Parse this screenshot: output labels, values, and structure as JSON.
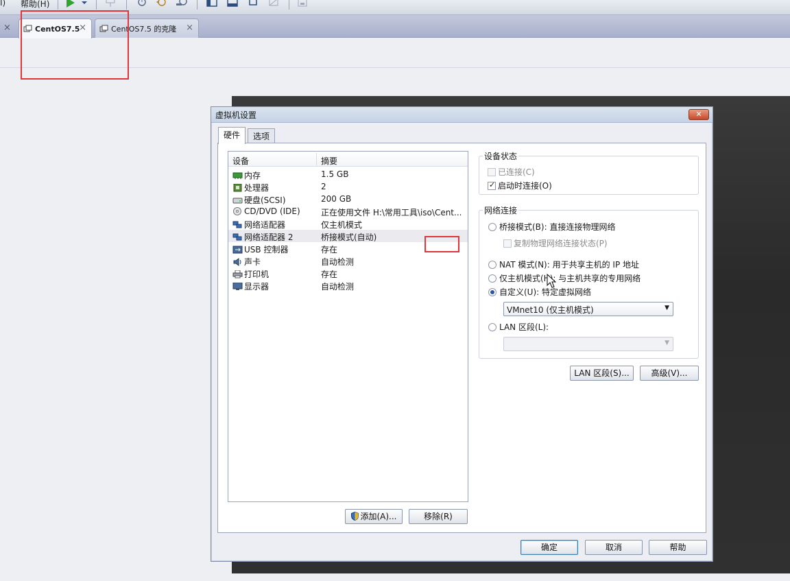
{
  "menubar": {
    "partial_item": "I)",
    "help_label": "帮助(H)"
  },
  "vm_tabs": [
    {
      "label": "CentOS7.5",
      "close": "×"
    },
    {
      "label": "CentOS7.5 的克隆",
      "close": "×"
    }
  ],
  "leftover_close": "×",
  "dialog": {
    "title": "虚拟机设置",
    "close": "✕",
    "tabs": {
      "hardware": "硬件",
      "options": "选项"
    },
    "device_table": {
      "col_device": "设备",
      "col_summary": "摘要",
      "rows": [
        {
          "name": "内存",
          "summary": "1.5 GB",
          "icon": "memory-icon"
        },
        {
          "name": "处理器",
          "summary": "2",
          "icon": "cpu-icon"
        },
        {
          "name": "硬盘(SCSI)",
          "summary": "200 GB",
          "icon": "harddisk-icon"
        },
        {
          "name": "CD/DVD (IDE)",
          "summary": "正在使用文件 H:\\常用工具\\iso\\Cent...",
          "icon": "cd-dvd-icon"
        },
        {
          "name": "网络适配器",
          "summary": "仅主机模式",
          "icon": "network-adapter-icon"
        },
        {
          "name": "网络适配器 2",
          "summary": "桥接模式(自动)",
          "icon": "network-adapter-icon"
        },
        {
          "name": "USB 控制器",
          "summary": "存在",
          "icon": "usb-icon"
        },
        {
          "name": "声卡",
          "summary": "自动检测",
          "icon": "sound-icon"
        },
        {
          "name": "打印机",
          "summary": "存在",
          "icon": "printer-icon"
        },
        {
          "name": "显示器",
          "summary": "自动检测",
          "icon": "display-icon"
        }
      ]
    },
    "add_button": "添加(A)...",
    "remove_button": "移除(R)",
    "device_status": {
      "legend": "设备状态",
      "connected": "已连接(C)",
      "connect_on_power_on": "启动时连接(O)"
    },
    "network_connection": {
      "legend": "网络连接",
      "bridged": "桥接模式(B): 直接连接物理网络",
      "replicate": "复制物理网络连接状态(P)",
      "nat": "NAT 模式(N): 用于共享主机的 IP 地址",
      "host_only": "仅主机模式(H): 与主机共享的专用网络",
      "custom": "自定义(U): 特定虚拟网络",
      "custom_value": "VMnet10 (仅主机模式)",
      "lan_segment": "LAN 区段(L):",
      "lan_value": ""
    },
    "lan_segments_button": "LAN 区段(S)...",
    "advanced_button": "高级(V)...",
    "ok_button": "确定",
    "cancel_button": "取消",
    "help_button": "帮助"
  }
}
